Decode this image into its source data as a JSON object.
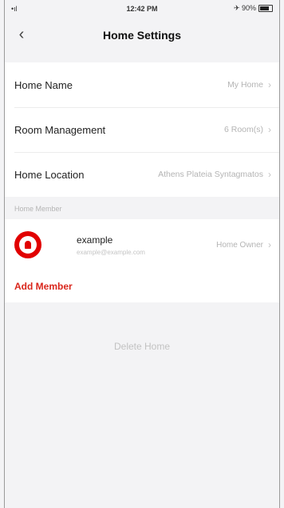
{
  "statusbar": {
    "signal": "•ıl",
    "time": "12:42 PM",
    "battery_text": "✈ 90%"
  },
  "navbar": {
    "title": "Home Settings",
    "back_icon": "‹"
  },
  "settings": {
    "home_name": {
      "label": "Home Name",
      "value": "My Home"
    },
    "room_management": {
      "label": "Room Management",
      "value": "6 Room(s)"
    },
    "home_location": {
      "label": "Home Location",
      "value": "Athens Plateia Syntagmatos"
    }
  },
  "members_section": {
    "header": "Home Member",
    "members": [
      {
        "name": "example",
        "email": "example@example.com",
        "role": "Home Owner"
      }
    ],
    "add_label": "Add Member"
  },
  "delete_label": "Delete Home",
  "colors": {
    "accent": "#d9261c",
    "avatar": "#e10000"
  },
  "icons": {
    "chevron": "›"
  }
}
